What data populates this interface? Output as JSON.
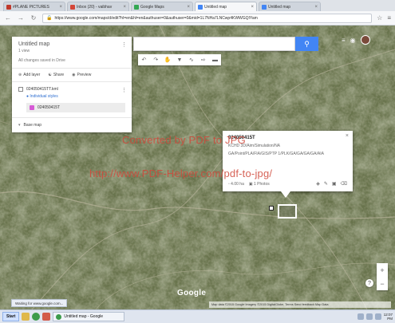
{
  "browser": {
    "tabs": [
      {
        "label": "#PLANE PICTURES",
        "active": false,
        "favicon_color": "#c0392b"
      },
      {
        "label": "Inbox (20) - vaibhav",
        "active": false,
        "favicon_color": "#d44638"
      },
      {
        "label": "Google Maps",
        "active": false,
        "favicon_color": "#34a853"
      },
      {
        "label": "Untitled map",
        "active": true,
        "favicon_color": "#4285f4"
      },
      {
        "label": "Untitled map",
        "active": false,
        "favicon_color": "#4285f4"
      }
    ],
    "url": "https://www.google.com/maps/d/edit?hl=en&hl=en&authuser=0&authuser=0&mid=1L7NHa7LNCwp4KWWGQIYam"
  },
  "map_panel": {
    "title": "Untitled map",
    "subtitle": "1 view",
    "saved_status": "All changes saved in Drive",
    "actions": {
      "add_layer": "Add layer",
      "share": "Share",
      "preview": "Preview"
    },
    "layer": {
      "name": "024050415TT.kml",
      "style_link": "Individual styles",
      "feature": "024050415T"
    },
    "base_map": "Base map"
  },
  "search": {
    "placeholder": ""
  },
  "info_card": {
    "title": "024050415T",
    "line1": "KCHD 3D/Aim/Simulation/NA",
    "line2": "GA/Point/PLA/FIA/GIS/PTP 1/PLK/GA/GA/GA/GA/AIA",
    "area": "4.00 ha",
    "photos": "1 Photos"
  },
  "watermark": {
    "line1": "Converted by PDF to JPG",
    "line2": "http://www.PDF-Helper.com/pdf-to-jpg/"
  },
  "map_footer": {
    "logo": "Google",
    "attribution": "Map data ©2015 Google Imagery ©2015 DigitalGlobe, Terms  Send feedback  Map Data",
    "status": "Waiting for www.google.com..."
  },
  "taskbar": {
    "start": "Start",
    "window": "Untitled map - Google",
    "clock_time": "12:07",
    "clock_date": "PM"
  },
  "colors": {
    "search_button": "#4285f4",
    "watermark": "#d0483a",
    "feature_pin": "#d65ad6"
  }
}
